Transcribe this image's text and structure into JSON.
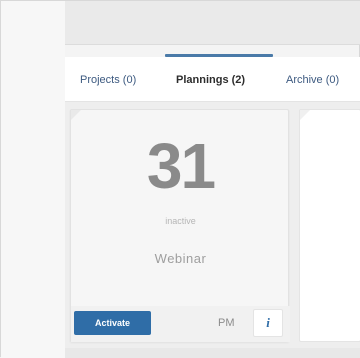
{
  "tabs": [
    {
      "label": "Projects (0)",
      "active": false
    },
    {
      "label": "Plannings (2)",
      "active": true
    },
    {
      "label": "Archive (0)",
      "active": false
    }
  ],
  "card": {
    "day": "31",
    "status": "inactive",
    "type": "Webinar",
    "activate_label": "Activate",
    "time_label": "PM",
    "info_glyph": "i"
  },
  "colors": {
    "accent": "#2f6da7",
    "tab_text": "#3d5a80",
    "day_number": "#8a8a8a"
  },
  "icons": {
    "info": "info-icon"
  }
}
